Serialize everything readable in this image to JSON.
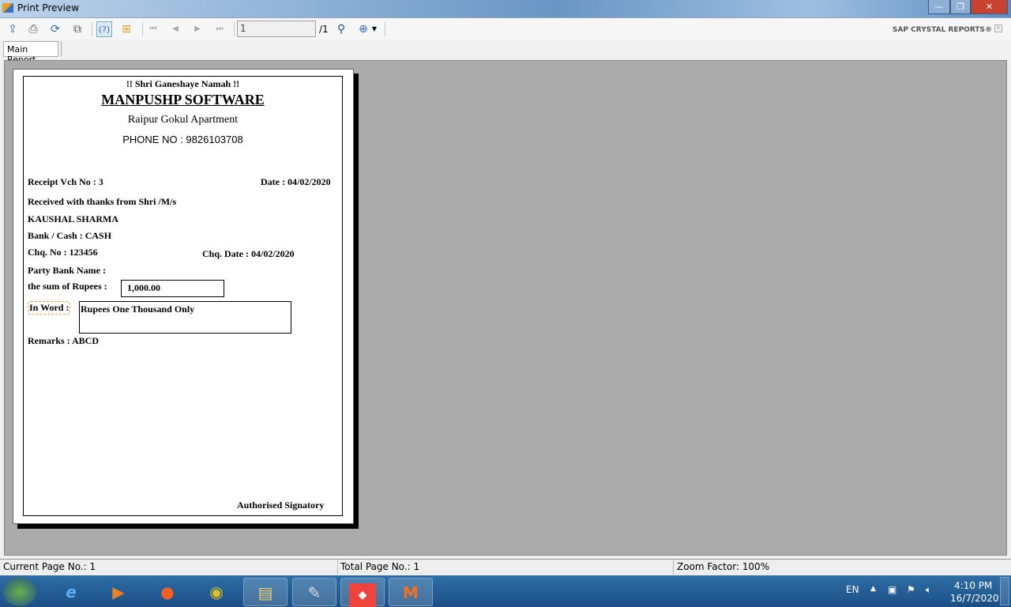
{
  "window": {
    "title": "Print Preview",
    "minimize": "—",
    "restore": "❐",
    "close": "✕"
  },
  "toolbar": {
    "page_value": "1",
    "page_total": "/1",
    "brand": "SAP CRYSTAL REPORTS®",
    "close_report": "✕"
  },
  "tabs": [
    {
      "label": "Main Report"
    }
  ],
  "report": {
    "blessing": "!! Shri Ganeshaye Namah !!",
    "company": "MANPUSHP SOFTWARE",
    "address": "Raipur Gokul Apartment",
    "phone": "PHONE NO : 9826103708",
    "receipt_no": "Receipt Vch No  : 3",
    "date": "Date : 04/02/2020",
    "received_from_label": "Received with thanks from Shri /M/s",
    "party_name": "KAUSHAL SHARMA",
    "bank_cash": "Bank / Cash   : CASH",
    "chq_no": "Chq. No  : 123456",
    "chq_date": "Chq. Date  : 04/02/2020",
    "party_bank": "Party Bank Name  :",
    "sum_label": "the sum of Rupees  :",
    "sum_value": "1,000.00",
    "in_word_label": "In Word :",
    "in_word_value": "Rupees One Thousand  Only",
    "remarks": "Remarks  :  ABCD",
    "signatory": "Authorised Signatory"
  },
  "status": {
    "current": "Current Page No.: 1",
    "total": "Total Page No.: 1",
    "zoom": "Zoom Factor: 100%"
  },
  "taskbar": {
    "lang": "EN",
    "time": "4:10 PM",
    "date": "16/7/2020"
  }
}
